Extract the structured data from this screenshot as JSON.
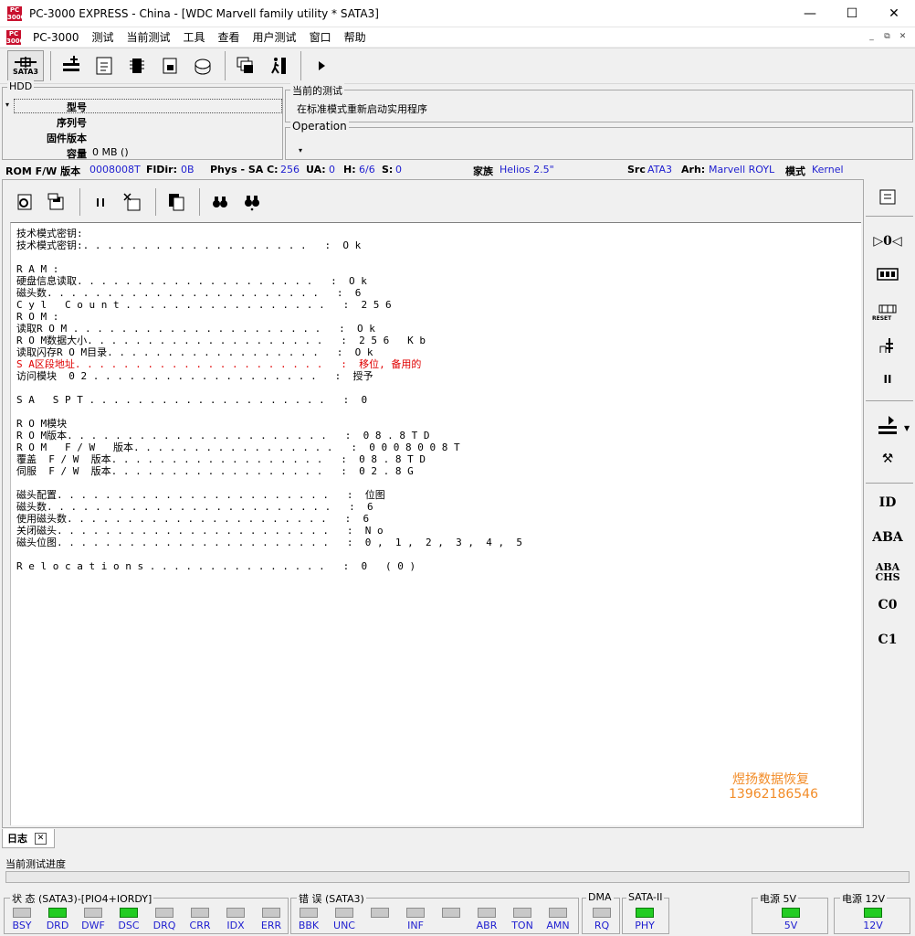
{
  "window": {
    "logo": "PC 3000",
    "title": "PC-3000 EXPRESS - China - [WDC Marvell family utility * SATA3]",
    "minimize": "—",
    "maximize": "☐",
    "close": "✕"
  },
  "menu": {
    "items": [
      "PC-3000",
      "测试",
      "当前测试",
      "工具",
      "查看",
      "用户测试",
      "窗口",
      "帮助"
    ],
    "mdi": [
      "_",
      "⧉",
      "✕"
    ]
  },
  "toolbar": {
    "sata_label": "SATA3"
  },
  "hdd": {
    "legend": "HDD",
    "model_label": "型号",
    "model_value": "",
    "serial_label": "序列号",
    "serial_value": "",
    "firmware_label": "固件版本",
    "firmware_value": "",
    "capacity_label": "容量",
    "capacity_value": "0 MB ()"
  },
  "current_test": {
    "legend": "当前的测试",
    "text": "在标准模式重新启动实用程序"
  },
  "operation": {
    "legend": "Operation"
  },
  "info": {
    "rom_fw_label": "ROM F/W 版本",
    "rom_fw_value": "0008008T",
    "fldir_label": "FlDir:",
    "fldir_value": "0B",
    "phys_label": "Phys - SA C:",
    "phys_c_value": "256",
    "ua_label": "UA:",
    "ua_value": "0",
    "h_label": "H:",
    "h_value": "6/6",
    "s_label": "S:",
    "s_value": "0",
    "family_label": "家族",
    "family_value": "Helios 2.5\"",
    "src_label": "Src",
    "src_value": "ATA3",
    "arh_label": "Arh:",
    "arh_value": "Marvell ROYL",
    "mode_label": "模式",
    "mode_value": "Kernel"
  },
  "log": {
    "lines": [
      "技术模式密钥:",
      "技术模式密钥:. . . . . . . . . . . . . . . . . . .   :  O k",
      "",
      "R A M :",
      "硬盘信息读取. . . . . . . . . . . . . . . . . . . .   :  O k",
      "磁头数. . . . . . . . . . . . . . . . . . . . . . .   :  6",
      "C y l   C o u n t . . . . . . . . . . . . . . . . .   :  2 5 6",
      "R O M :",
      "读取R O M . . . . . . . . . . . . . . . . . . . . .   :  O k",
      "R O M数据大小. . . . . . . . . . . . . . . . . . . .   :  2 5 6   K b",
      "读取闪存R O M目录. . . . . . . . . . . . . . . . . .   :  O k",
      "S A区段地址. . . . . . . . . . . . . . . . . . . . .   :  移位, 备用的",
      "访问模块  0 2 . . . . . . . . . . . . . . . . . . .   :  授予",
      "",
      "S A   S P T . . . . . . . . . . . . . . . . . . . .   :  0",
      "",
      "R O M模块",
      "R O M版本. . . . . . . . . . . . . . . . . . . . . .   :  0 8 . 8 T D",
      "R O M   F / W   版本. . . . . . . . . . . . . . . . .   :  0 0 0 8 0 0 8 T",
      "覆盖  F / W  版本. . . . . . . . . . . . . . . . . .   :  0 8 . 8 T D",
      "伺服  F / W  版本. . . . . . . . . . . . . . . . . .   :  0 2 . 8 G",
      "",
      "磁头配置. . . . . . . . . . . . . . . . . . . . . . .   :  位图",
      "磁头数. . . . . . . . . . . . . . . . . . . . . . . .   :  6",
      "使用磁头数. . . . . . . . . . . . . . . . . . . . . .   :  6",
      "关闭磁头. . . . . . . . . . . . . . . . . . . . . . .   :  N o",
      "磁头位图. . . . . . . . . . . . . . . . . . . . . . .   :  0 ,  1 ,  2 ,  3 ,  4 ,  5",
      "",
      "R e l o c a t i o n s . . . . . . . . . . . . . . .   :  0   ( 0 )"
    ],
    "red_line_index": 11
  },
  "watermark": {
    "name": "煜扬数据恢复",
    "phone": "13962186546",
    "color": "#f28c28"
  },
  "right_toolbar": {
    "labels": [
      "",
      "▷0◁",
      "",
      "RESET",
      "",
      "II",
      "",
      "⚒",
      "ID",
      "ABA",
      "ABA CHS",
      "C0",
      "C1"
    ]
  },
  "log_tab": {
    "label": "日志",
    "close": "✕"
  },
  "progress": {
    "label": "当前测试进度",
    "value": 0
  },
  "status_group": {
    "legend": "状 态 (SATA3)-[PIO4+IORDY]",
    "indicators": [
      {
        "name": "BSY",
        "on": false
      },
      {
        "name": "DRD",
        "on": true
      },
      {
        "name": "DWF",
        "on": false
      },
      {
        "name": "DSC",
        "on": true
      },
      {
        "name": "DRQ",
        "on": false
      },
      {
        "name": "CRR",
        "on": false
      },
      {
        "name": "IDX",
        "on": false
      },
      {
        "name": "ERR",
        "on": false
      }
    ]
  },
  "error_group": {
    "legend": "错 误 (SATA3)",
    "indicators": [
      {
        "name": "BBK",
        "on": false
      },
      {
        "name": "UNC",
        "on": false
      },
      {
        "name": "",
        "on": false
      },
      {
        "name": "INF",
        "on": false
      },
      {
        "name": "",
        "on": false
      },
      {
        "name": "ABR",
        "on": false
      },
      {
        "name": "TON",
        "on": false
      },
      {
        "name": "AMN",
        "on": false
      }
    ]
  },
  "dma_group": {
    "legend": "DMA",
    "indicator": {
      "name": "RQ",
      "on": false
    }
  },
  "sata_group": {
    "legend": "SATA-II",
    "indicator": {
      "name": "PHY",
      "on": true
    }
  },
  "power5_group": {
    "legend": "电源 5V",
    "indicator": {
      "name": "5V",
      "on": true
    }
  },
  "power12_group": {
    "legend": "电源 12V",
    "indicator": {
      "name": "12V",
      "on": true
    }
  },
  "colors": {
    "accent_blue": "#2020d0",
    "led_on": "#22cc22",
    "led_off": "#c8c8c8",
    "error_red": "#e00000"
  }
}
